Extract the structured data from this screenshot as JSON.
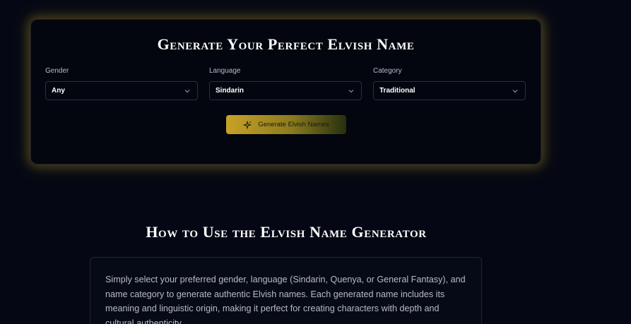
{
  "generator": {
    "title": "Generate Your Perfect Elvish Name",
    "fields": [
      {
        "label": "Gender",
        "value": "Any"
      },
      {
        "label": "Language",
        "value": "Sindarin"
      },
      {
        "label": "Category",
        "value": "Traditional"
      }
    ],
    "button_label": "Generate Elvish Names",
    "button_icon": "sparkles-icon",
    "accent_color": "#c9a227"
  },
  "how_to": {
    "title": "How to Use the Elvish Name Generator",
    "text": "Simply select your preferred gender, language (Sindarin, Quenya, or General Fantasy), and name category to generate authentic Elvish names. Each generated name includes its meaning and linguistic origin, making it perfect for creating characters with depth and cultural authenticity."
  }
}
